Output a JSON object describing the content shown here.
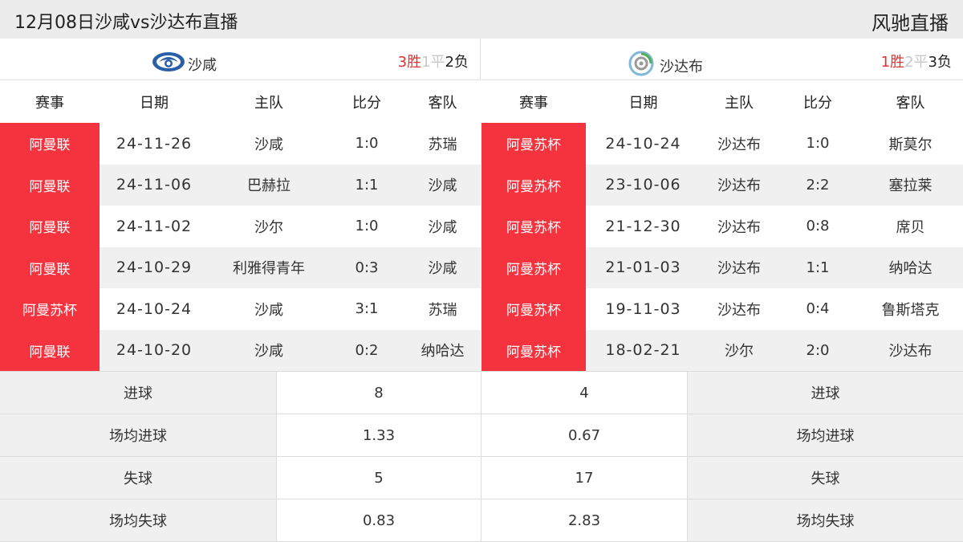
{
  "header": {
    "title": "12月08日沙咸vs沙达布直播",
    "brand": "风驰直播"
  },
  "home_team": {
    "name": "沙咸",
    "record": {
      "win": "3胜",
      "draw": "1平",
      "lose": "2负"
    },
    "columns": [
      "赛事",
      "日期",
      "主队",
      "比分",
      "客队"
    ],
    "matches": [
      {
        "comp": "阿曼联",
        "date": "24-11-26",
        "home": "沙咸",
        "score": "1:0",
        "away": "苏瑞"
      },
      {
        "comp": "阿曼联",
        "date": "24-11-06",
        "home": "巴赫拉",
        "score": "1:1",
        "away": "沙咸"
      },
      {
        "comp": "阿曼联",
        "date": "24-11-02",
        "home": "沙尔",
        "score": "1:0",
        "away": "沙咸"
      },
      {
        "comp": "阿曼联",
        "date": "24-10-29",
        "home": "利雅得青年",
        "score": "0:3",
        "away": "沙咸"
      },
      {
        "comp": "阿曼苏杯",
        "date": "24-10-24",
        "home": "沙咸",
        "score": "3:1",
        "away": "苏瑞"
      },
      {
        "comp": "阿曼联",
        "date": "24-10-20",
        "home": "沙咸",
        "score": "0:2",
        "away": "纳哈达"
      }
    ]
  },
  "away_team": {
    "name": "沙达布",
    "record": {
      "win": "1胜",
      "draw": "2平",
      "lose": "3负"
    },
    "columns": [
      "赛事",
      "日期",
      "主队",
      "比分",
      "客队"
    ],
    "matches": [
      {
        "comp": "阿曼苏杯",
        "date": "24-10-24",
        "home": "沙达布",
        "score": "1:0",
        "away": "斯莫尔"
      },
      {
        "comp": "阿曼苏杯",
        "date": "23-10-06",
        "home": "沙达布",
        "score": "2:2",
        "away": "塞拉莱"
      },
      {
        "comp": "阿曼苏杯",
        "date": "21-12-30",
        "home": "沙达布",
        "score": "0:8",
        "away": "席贝"
      },
      {
        "comp": "阿曼苏杯",
        "date": "21-01-03",
        "home": "沙达布",
        "score": "1:1",
        "away": "纳哈达"
      },
      {
        "comp": "阿曼苏杯",
        "date": "19-11-03",
        "home": "沙达布",
        "score": "0:4",
        "away": "鲁斯塔克"
      },
      {
        "comp": "阿曼苏杯",
        "date": "18-02-21",
        "home": "沙尔",
        "score": "2:0",
        "away": "沙达布"
      }
    ]
  },
  "stats": [
    {
      "label": "进球",
      "home": "8",
      "away": "4"
    },
    {
      "label": "场均进球",
      "home": "1.33",
      "away": "0.67"
    },
    {
      "label": "失球",
      "home": "5",
      "away": "17"
    },
    {
      "label": "场均失球",
      "home": "0.83",
      "away": "2.83"
    }
  ],
  "colors": {
    "comp_badge": "#f5333f",
    "win": "#e03131",
    "draw": "#c8c8c8",
    "alt_row": "#f0f0f0"
  },
  "icons": {
    "home_logo": "shabab-club-logo-icon",
    "away_logo": "swirl-club-logo-icon"
  }
}
